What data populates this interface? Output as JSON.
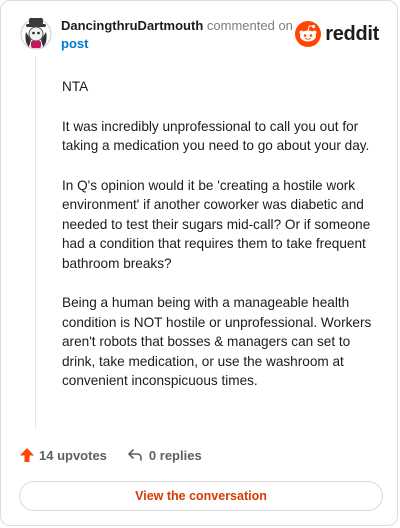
{
  "header": {
    "author": "DancingthruDartmouth",
    "action": "commented on",
    "target": "post",
    "logo_text": "reddit"
  },
  "comment": {
    "paragraphs": [
      "NTA",
      "It was incredibly unprofessional to call you out for taking a medication you need to go about your day.",
      "In Q's opinion would it be 'creating a hostile work environment' if another coworker was diabetic and needed to test their sugars mid-call? Or if someone had a condition that requires them to take frequent bathroom breaks?",
      "Being a human being with a manageable health condition is NOT hostile or unprofessional. Workers aren't robots that bosses & managers can set to drink, take medication, or use the washroom at convenient inconspicuous times."
    ]
  },
  "footer": {
    "upvotes": "14 upvotes",
    "replies": "0 replies",
    "view_button": "View the conversation",
    "upvote_icon": "upvote-arrow-icon",
    "reply_icon": "reply-arrow-icon"
  },
  "colors": {
    "brand_orange": "#ff4500",
    "link_blue": "#0079d3",
    "button_text": "#d93a00"
  }
}
